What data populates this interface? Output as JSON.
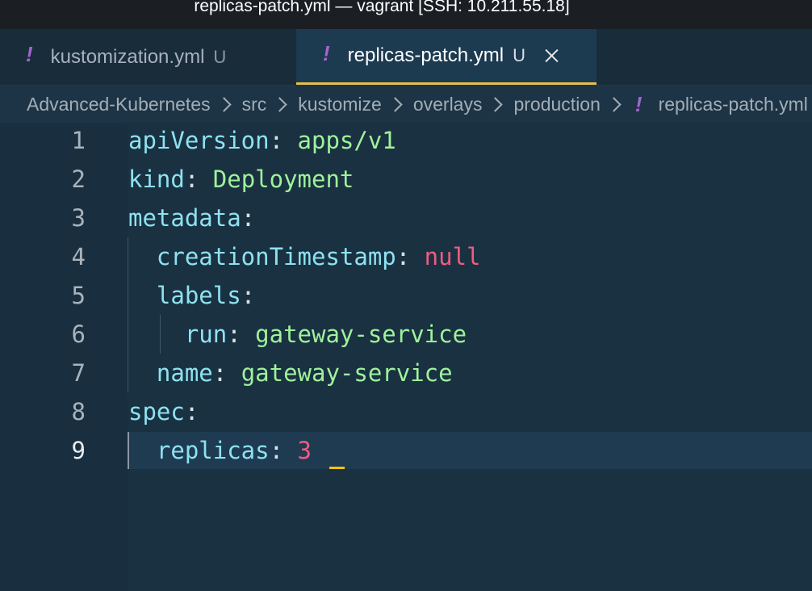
{
  "window": {
    "title": "replicas-patch.yml — vagrant [SSH: 10.211.55.18]"
  },
  "tabs": [
    {
      "icon": "!",
      "label": "kustomization.yml",
      "status": "U"
    },
    {
      "icon": "!",
      "label": "replicas-patch.yml",
      "status": "U"
    }
  ],
  "breadcrumb": {
    "items": [
      "Advanced-Kubernetes",
      "src",
      "kustomize",
      "overlays",
      "production"
    ],
    "file_icon": "!",
    "file": "replicas-patch.yml"
  },
  "editor": {
    "line_numbers": [
      "1",
      "2",
      "3",
      "4",
      "5",
      "6",
      "7",
      "8",
      "9"
    ],
    "lines": [
      {
        "key": "apiVersion",
        "colon": ":",
        "value": " apps/v1"
      },
      {
        "key": "kind",
        "colon": ":",
        "value": " Deployment"
      },
      {
        "key": "metadata",
        "colon": ":",
        "value": ""
      },
      {
        "key": "creationTimestamp",
        "colon": ":",
        "value": " null"
      },
      {
        "key": "labels",
        "colon": ":",
        "value": ""
      },
      {
        "key": "run",
        "colon": ":",
        "value": " gateway-service"
      },
      {
        "key": "name",
        "colon": ":",
        "value": " gateway-service"
      },
      {
        "key": "spec",
        "colon": ":",
        "value": ""
      },
      {
        "key": "replicas",
        "colon": ":",
        "value": " 3"
      }
    ],
    "active_line": "9"
  },
  "colors": {
    "key": "#8ee2f0",
    "string": "#9ff29a",
    "number_null": "#f05c80",
    "accent": "#e5c04a",
    "yaml_icon": "#a465d0"
  },
  "icons": {
    "tab_file": "yaml-exclamation-icon",
    "close": "close-icon",
    "separator": "chevron-right-icon"
  }
}
